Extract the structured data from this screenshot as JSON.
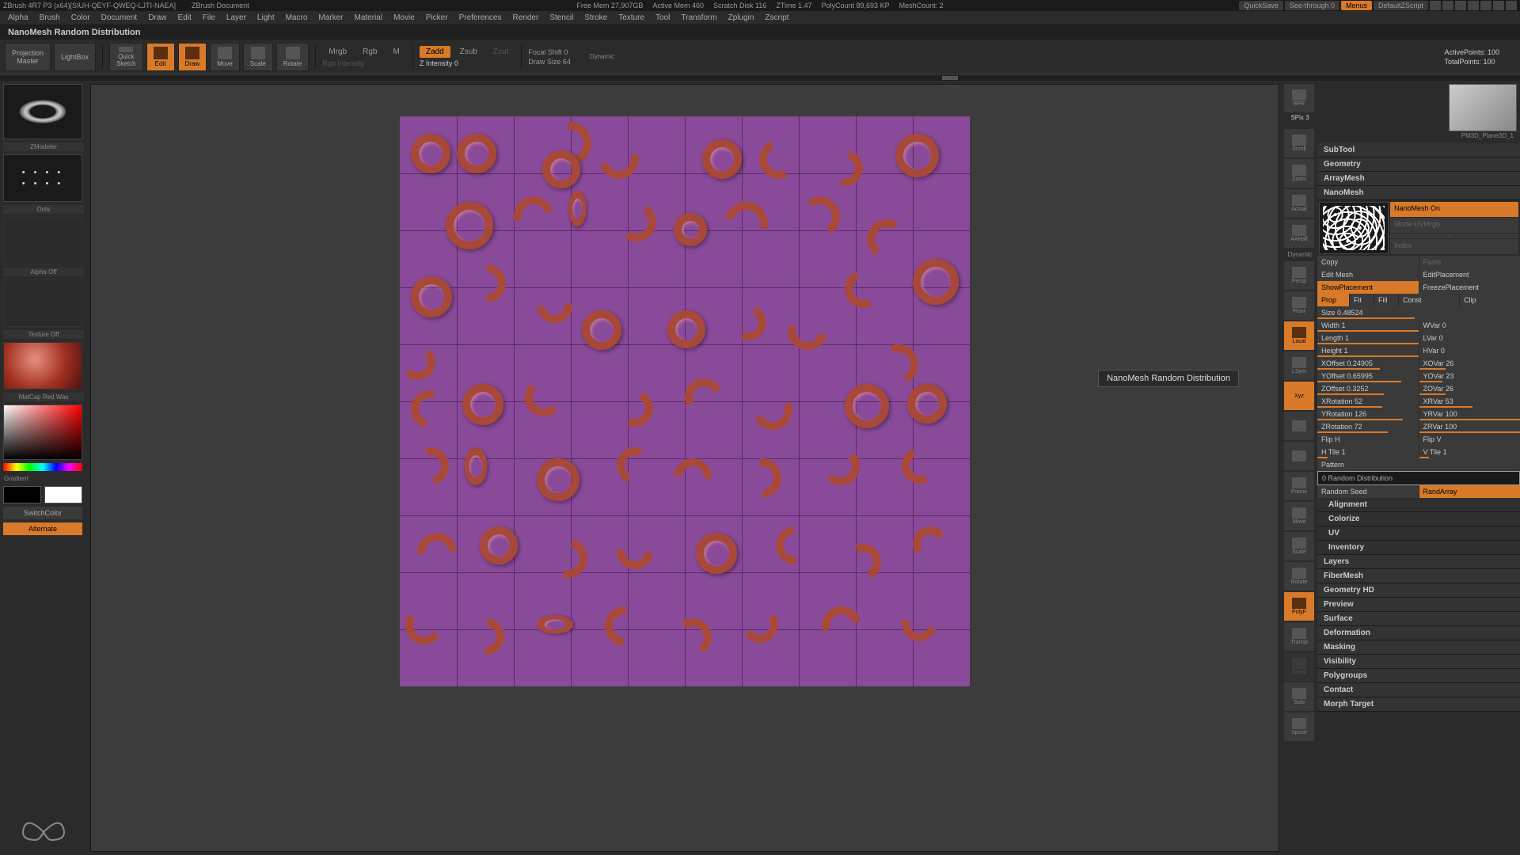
{
  "titlebar": {
    "app": "ZBrush 4R7 P3 (x64)[SIUH-QEYF-QWEQ-LJTI-NAEA]",
    "doc": "ZBrush Document",
    "stats": [
      "Free Mem 27,907GB",
      "Active Mem 460",
      "Scratch Disk 116",
      "ZTime 1.47",
      "PolyCount 89,693 KP",
      "MeshCount: 2"
    ],
    "quicksave": "QuickSave",
    "seethrough": "See-through  0",
    "menus": "Menus",
    "script": "DefaultZScript"
  },
  "menubar": [
    "Alpha",
    "Brush",
    "Color",
    "Document",
    "Draw",
    "Edit",
    "File",
    "Layer",
    "Light",
    "Macro",
    "Marker",
    "Material",
    "Movie",
    "Picker",
    "Preferences",
    "Render",
    "Stencil",
    "Stroke",
    "Texture",
    "Tool",
    "Transform",
    "Zplugin",
    "Zscript"
  ],
  "statusline": "NanoMesh Random Distribution",
  "toolbar": {
    "projection": "Projection\nMaster",
    "lightbox": "LightBox",
    "quicksketch": "Quick\nSketch",
    "edit": "Edit",
    "draw": "Draw",
    "move": "Move",
    "scale": "Scale",
    "rotate": "Rotate",
    "mrgb": "Mrgb",
    "rgb": "Rgb",
    "m": "M",
    "rgb_intensity": "Rgb Intensity",
    "zadd": "Zadd",
    "zsub": "Zsub",
    "zcut": "Zcut",
    "zintensity": "Z Intensity 0",
    "focal": "Focal Shift 0",
    "drawsize": "Draw Size 64",
    "dynamic": "Dynamic",
    "activepoints": "ActivePoints: 100",
    "totalpoints": "TotalPoints: 100"
  },
  "left": {
    "zmodeler": "ZModeler",
    "dots": "Dots",
    "alpha_off": "Alpha Off",
    "texture_off": "Texture Off",
    "matcap": "MatCap Red Wax",
    "gradient": "Gradient",
    "switchcolor": "SwitchColor",
    "alternate": "Alternate"
  },
  "tooltip": "NanoMesh Random Distribution",
  "rightstrip": {
    "spix": "SPix 3",
    "labels": [
      "BPR",
      "Scroll",
      "Zoom",
      "Actual",
      "AAHalf",
      "Persp",
      "Floor",
      "Local",
      "LSym",
      "Xyz",
      "",
      "",
      "Frame",
      "Move",
      "Scale",
      "Rotate",
      "PolyF",
      "Transp",
      "Ghost",
      "",
      "Solo",
      "Xpose"
    ],
    "dynamic": "Dynamic"
  },
  "toolthumb": "PM3D_Plane3D_1",
  "props": {
    "sections": [
      "SubTool",
      "Geometry",
      "ArrayMesh",
      "NanoMesh",
      "Layers",
      "FiberMesh",
      "Geometry HD",
      "Preview",
      "Surface",
      "Deformation",
      "Masking",
      "Visibility",
      "Polygroups",
      "Contact",
      "Morph Target"
    ],
    "nanomesh_on": "NanoMesh On",
    "mode_uvmrgb": "Mode UVMrgb",
    "index_label": "Index",
    "gizmo": "",
    "copy": "Copy",
    "paste": "Paste",
    "editmesh": "Edit Mesh",
    "editplacement": "EditPlacement",
    "showplacement": "ShowPlacement",
    "freezeplacement": "FreezePlacement",
    "prop": "Prop",
    "fit": "Fit",
    "fill": "Fill",
    "const": "Const",
    "clip": "Clip",
    "size": "Size 0.48524",
    "width": "Width 1",
    "wvar": "WVar 0",
    "length": "Length 1",
    "lvar": "LVar 0",
    "height": "Height 1",
    "hvar": "HVar 0",
    "xoffset": "XOffset 0.24905",
    "xovar": "XOVar 26",
    "yoffset": "YOffset 0.65995",
    "yovar": "YOVar 23",
    "zoffset": "ZOffset 0.3252",
    "zovar": "ZOVar 26",
    "xrotation": "XRotation 52",
    "xrvar": "XRVar 53",
    "yrotation": "YRotation 126",
    "yrvar": "YRVar 100",
    "zrotation": "ZRotation 72",
    "zrvar": "ZRVar 100",
    "fliph": "Flip H",
    "flipv": "Flip V",
    "htile": "H Tile 1",
    "vtile": "V Tile 1",
    "pattern": "Pattern",
    "random_dist": "0 Random Distribution",
    "random_seed": "Random Seed",
    "randarray": "RandArray",
    "alignment": "Alignment",
    "colorize": "Colorize",
    "uv": "UV",
    "inventory": "Inventory"
  }
}
